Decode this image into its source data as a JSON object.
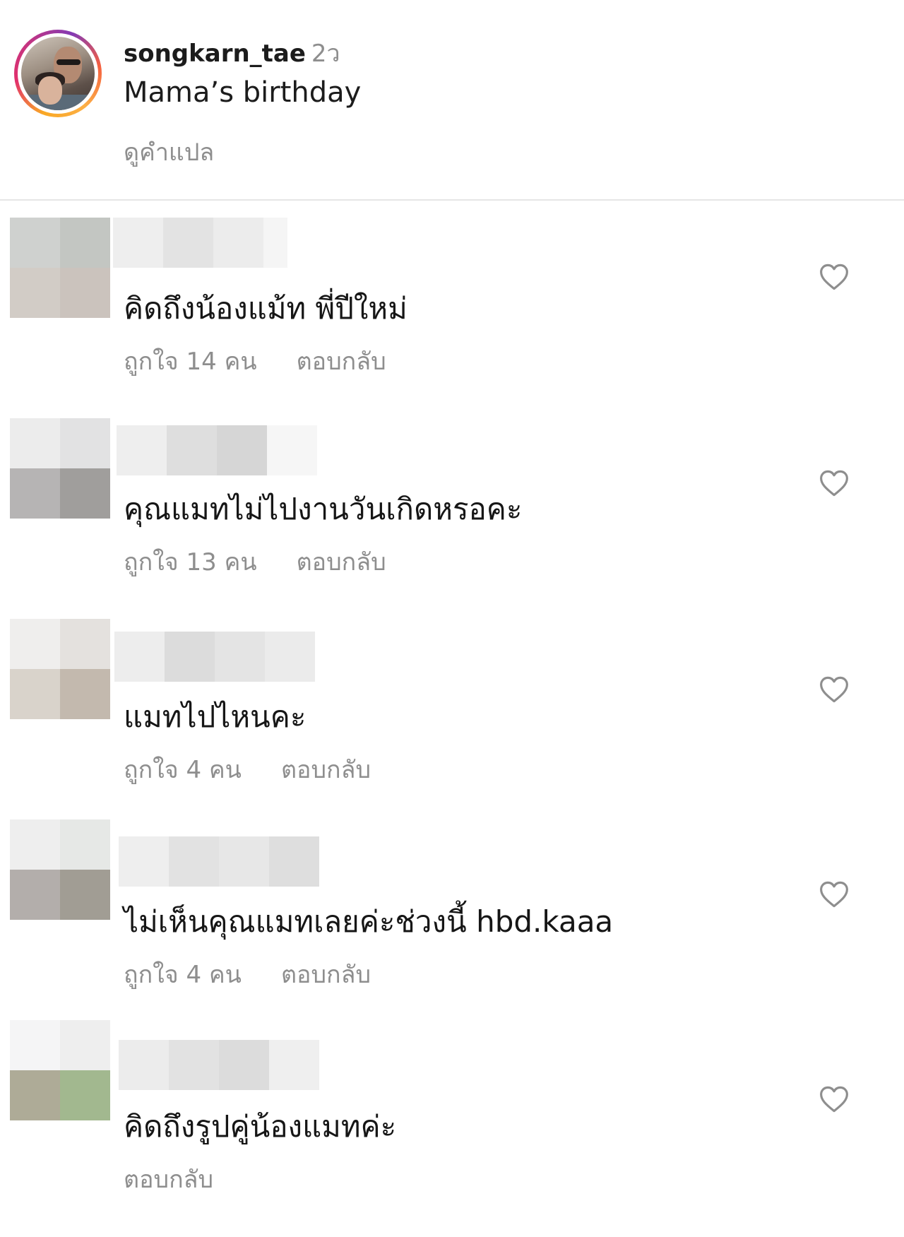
{
  "post": {
    "username": "songkarn_tae",
    "time_ago": "2ว",
    "caption": "Mama’s birthday",
    "translate_label": "ดูคำแปล"
  },
  "comments": [
    {
      "text": "คิดถึงน้องแม้ท พี่ปีใหม่",
      "likes_label": "ถูกใจ 14 คน",
      "reply_label": "ตอบกลับ",
      "avatar_colors": [
        "#cfd1cf",
        "#c3c6c2",
        "#d2ccc6",
        "#cbc3bd"
      ],
      "name_colors": [
        "#eeeeee",
        "#e3e3e3",
        "#ececec",
        "#f5f5f5"
      ],
      "name_blocks": 4
    },
    {
      "text": "คุณแมทไม่ไปงานวันเกิดหรอคะ",
      "likes_label": "ถูกใจ 13 คน",
      "reply_label": "ตอบกลับ",
      "avatar_colors": [
        "#ececec",
        "#e2e2e3",
        "#b6b4b4",
        "#a09e9c"
      ],
      "name_colors": [
        "#eeeeee",
        "#dedede",
        "#d6d6d6",
        "#f6f6f6"
      ],
      "name_blocks": 4
    },
    {
      "text": "แมทไปไหนคะ",
      "likes_label": "ถูกใจ 4 คน",
      "reply_label": "ตอบกลับ",
      "avatar_colors": [
        "#efeeed",
        "#e4e1de",
        "#d9d3cb",
        "#c3b9ae"
      ],
      "name_colors": [
        "#ededed",
        "#dcdcdc",
        "#e4e4e4",
        "#ebebeb"
      ],
      "name_blocks": 4
    },
    {
      "text": "ไม่เห็นคุณแมทเลยค่ะช่วงนี้ hbd.kaaa",
      "likes_label": "ถูกใจ 4 คน",
      "reply_label": "ตอบกลับ",
      "avatar_colors": [
        "#eeeeee",
        "#e6e8e6",
        "#b3aeab",
        "#a19d94"
      ],
      "name_colors": [
        "#eeeeee",
        "#e2e2e2",
        "#e7e7e7",
        "#dedede"
      ],
      "name_blocks": 4
    },
    {
      "text": "คิดถึงรูปคู่น้องแมทค่ะ",
      "likes_label": "",
      "reply_label": "ตอบกลับ",
      "avatar_colors": [
        "#f5f5f6",
        "#eeeeee",
        "#aeab97",
        "#a2b88f"
      ],
      "name_colors": [
        "#ececec",
        "#e2e2e2",
        "#dcdcdc",
        "#efefef"
      ],
      "name_blocks": 4
    }
  ]
}
